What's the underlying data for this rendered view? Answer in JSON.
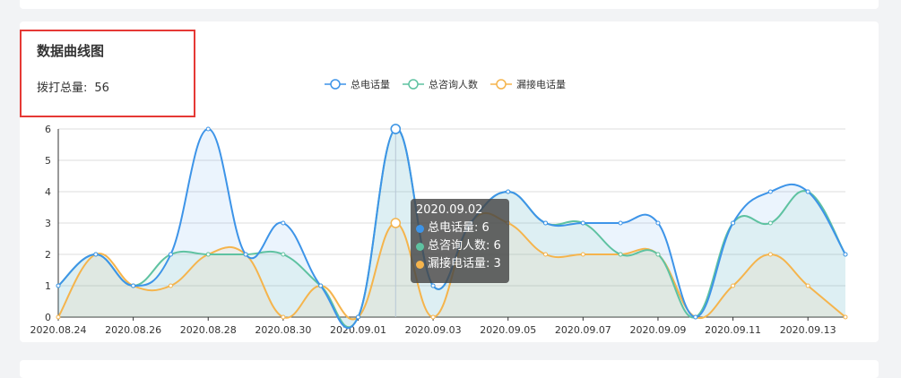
{
  "panel": {
    "title": "数据曲线图",
    "total_label": "拨打总量:",
    "total_value": "56"
  },
  "colors": {
    "series1": "#3d94e8",
    "series2": "#5ec2a1",
    "series3": "#f5b44c"
  },
  "tooltip": {
    "date": "2020.09.02",
    "rows": [
      {
        "label": "总电话量: 6"
      },
      {
        "label": "总咨询人数: 6"
      },
      {
        "label": "漏接电话量: 3"
      }
    ]
  },
  "chart_data": {
    "type": "area",
    "x": [
      "2020.08.24",
      "2020.08.25",
      "2020.08.26",
      "2020.08.27",
      "2020.08.28",
      "2020.08.29",
      "2020.08.30",
      "2020.08.31",
      "2020.09.01",
      "2020.09.02",
      "2020.09.03",
      "2020.09.04",
      "2020.09.05",
      "2020.09.06",
      "2020.09.07",
      "2020.09.08",
      "2020.09.09",
      "2020.09.10",
      "2020.09.11",
      "2020.09.12",
      "2020.09.13",
      "2020.09.14"
    ],
    "x_tick_labels": [
      "2020.08.24",
      "2020.08.26",
      "2020.08.28",
      "2020.08.30",
      "2020.09.01",
      "2020.09.03",
      "2020.09.05",
      "2020.09.07",
      "2020.09.09",
      "2020.09.11",
      "2020.09.13"
    ],
    "series": [
      {
        "name": "总电话量",
        "values": [
          1,
          2,
          1,
          2,
          6,
          2,
          3,
          1,
          0,
          6,
          1,
          3,
          4,
          3,
          3,
          3,
          3,
          0,
          3,
          4,
          4,
          2
        ]
      },
      {
        "name": "总咨询人数",
        "values": [
          1,
          2,
          1,
          2,
          2,
          2,
          2,
          1,
          0,
          6,
          1,
          3,
          4,
          3,
          3,
          2,
          2,
          0,
          3,
          3,
          4,
          2
        ]
      },
      {
        "name": "漏接电话量",
        "values": [
          0,
          2,
          1,
          1,
          2,
          2,
          0,
          1,
          0,
          3,
          0,
          3,
          3,
          2,
          2,
          2,
          2,
          0,
          1,
          2,
          1,
          0
        ]
      }
    ],
    "ylim": [
      0,
      6
    ],
    "y_ticks": [
      0,
      1,
      2,
      3,
      4,
      5,
      6
    ],
    "grid": true,
    "legend_position": "top-center"
  }
}
